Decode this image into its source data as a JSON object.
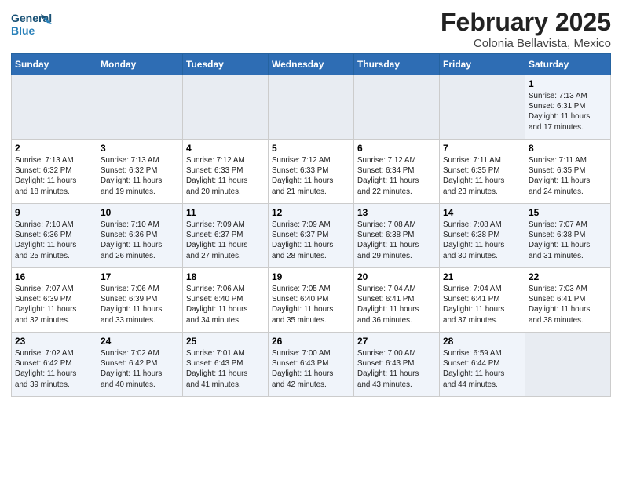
{
  "header": {
    "logo_general": "General",
    "logo_blue": "Blue",
    "month_title": "February 2025",
    "subtitle": "Colonia Bellavista, Mexico"
  },
  "weekdays": [
    "Sunday",
    "Monday",
    "Tuesday",
    "Wednesday",
    "Thursday",
    "Friday",
    "Saturday"
  ],
  "weeks": [
    [
      {
        "day": "",
        "info": ""
      },
      {
        "day": "",
        "info": ""
      },
      {
        "day": "",
        "info": ""
      },
      {
        "day": "",
        "info": ""
      },
      {
        "day": "",
        "info": ""
      },
      {
        "day": "",
        "info": ""
      },
      {
        "day": "1",
        "info": "Sunrise: 7:13 AM\nSunset: 6:31 PM\nDaylight: 11 hours\nand 17 minutes."
      }
    ],
    [
      {
        "day": "2",
        "info": "Sunrise: 7:13 AM\nSunset: 6:32 PM\nDaylight: 11 hours\nand 18 minutes."
      },
      {
        "day": "3",
        "info": "Sunrise: 7:13 AM\nSunset: 6:32 PM\nDaylight: 11 hours\nand 19 minutes."
      },
      {
        "day": "4",
        "info": "Sunrise: 7:12 AM\nSunset: 6:33 PM\nDaylight: 11 hours\nand 20 minutes."
      },
      {
        "day": "5",
        "info": "Sunrise: 7:12 AM\nSunset: 6:33 PM\nDaylight: 11 hours\nand 21 minutes."
      },
      {
        "day": "6",
        "info": "Sunrise: 7:12 AM\nSunset: 6:34 PM\nDaylight: 11 hours\nand 22 minutes."
      },
      {
        "day": "7",
        "info": "Sunrise: 7:11 AM\nSunset: 6:35 PM\nDaylight: 11 hours\nand 23 minutes."
      },
      {
        "day": "8",
        "info": "Sunrise: 7:11 AM\nSunset: 6:35 PM\nDaylight: 11 hours\nand 24 minutes."
      }
    ],
    [
      {
        "day": "9",
        "info": "Sunrise: 7:10 AM\nSunset: 6:36 PM\nDaylight: 11 hours\nand 25 minutes."
      },
      {
        "day": "10",
        "info": "Sunrise: 7:10 AM\nSunset: 6:36 PM\nDaylight: 11 hours\nand 26 minutes."
      },
      {
        "day": "11",
        "info": "Sunrise: 7:09 AM\nSunset: 6:37 PM\nDaylight: 11 hours\nand 27 minutes."
      },
      {
        "day": "12",
        "info": "Sunrise: 7:09 AM\nSunset: 6:37 PM\nDaylight: 11 hours\nand 28 minutes."
      },
      {
        "day": "13",
        "info": "Sunrise: 7:08 AM\nSunset: 6:38 PM\nDaylight: 11 hours\nand 29 minutes."
      },
      {
        "day": "14",
        "info": "Sunrise: 7:08 AM\nSunset: 6:38 PM\nDaylight: 11 hours\nand 30 minutes."
      },
      {
        "day": "15",
        "info": "Sunrise: 7:07 AM\nSunset: 6:38 PM\nDaylight: 11 hours\nand 31 minutes."
      }
    ],
    [
      {
        "day": "16",
        "info": "Sunrise: 7:07 AM\nSunset: 6:39 PM\nDaylight: 11 hours\nand 32 minutes."
      },
      {
        "day": "17",
        "info": "Sunrise: 7:06 AM\nSunset: 6:39 PM\nDaylight: 11 hours\nand 33 minutes."
      },
      {
        "day": "18",
        "info": "Sunrise: 7:06 AM\nSunset: 6:40 PM\nDaylight: 11 hours\nand 34 minutes."
      },
      {
        "day": "19",
        "info": "Sunrise: 7:05 AM\nSunset: 6:40 PM\nDaylight: 11 hours\nand 35 minutes."
      },
      {
        "day": "20",
        "info": "Sunrise: 7:04 AM\nSunset: 6:41 PM\nDaylight: 11 hours\nand 36 minutes."
      },
      {
        "day": "21",
        "info": "Sunrise: 7:04 AM\nSunset: 6:41 PM\nDaylight: 11 hours\nand 37 minutes."
      },
      {
        "day": "22",
        "info": "Sunrise: 7:03 AM\nSunset: 6:41 PM\nDaylight: 11 hours\nand 38 minutes."
      }
    ],
    [
      {
        "day": "23",
        "info": "Sunrise: 7:02 AM\nSunset: 6:42 PM\nDaylight: 11 hours\nand 39 minutes."
      },
      {
        "day": "24",
        "info": "Sunrise: 7:02 AM\nSunset: 6:42 PM\nDaylight: 11 hours\nand 40 minutes."
      },
      {
        "day": "25",
        "info": "Sunrise: 7:01 AM\nSunset: 6:43 PM\nDaylight: 11 hours\nand 41 minutes."
      },
      {
        "day": "26",
        "info": "Sunrise: 7:00 AM\nSunset: 6:43 PM\nDaylight: 11 hours\nand 42 minutes."
      },
      {
        "day": "27",
        "info": "Sunrise: 7:00 AM\nSunset: 6:43 PM\nDaylight: 11 hours\nand 43 minutes."
      },
      {
        "day": "28",
        "info": "Sunrise: 6:59 AM\nSunset: 6:44 PM\nDaylight: 11 hours\nand 44 minutes."
      },
      {
        "day": "",
        "info": ""
      }
    ]
  ]
}
